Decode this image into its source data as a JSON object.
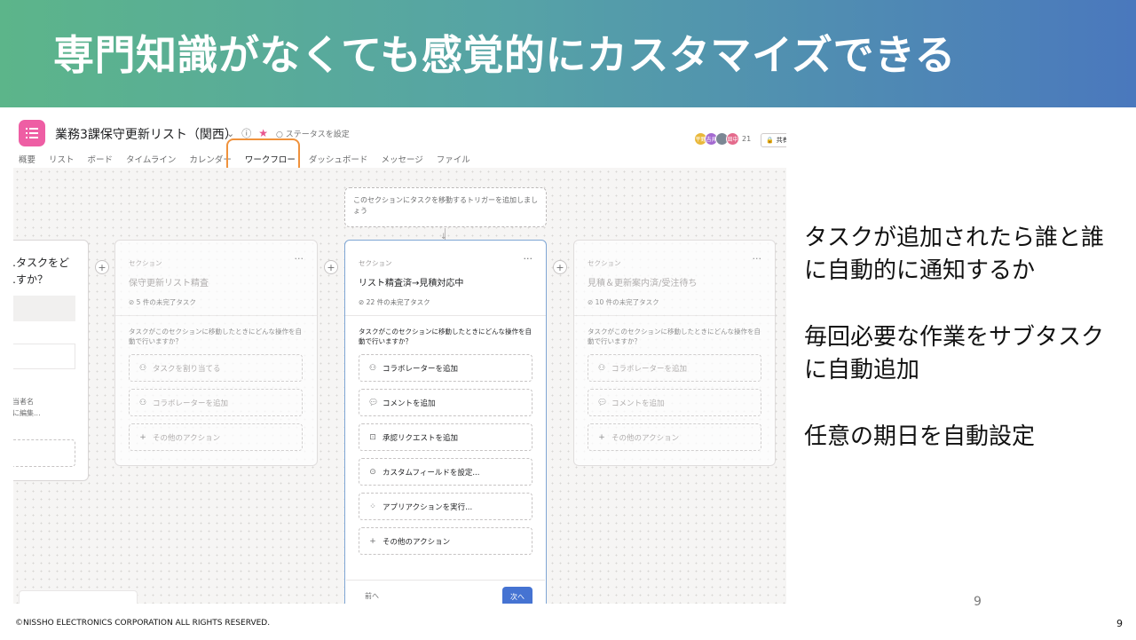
{
  "slide": {
    "title": "専門知識がなくても感覚的にカスタマイズできる",
    "points": [
      "タスクが追加されたら誰と誰に自動的に通知するか",
      "毎回必要な作業をサブタスクに自動追加",
      "任意の期日を自動設定"
    ],
    "page_mid": "9",
    "copyright": "©NISSHO ELECTRONICS CORPORATION ALL RIGHTS RESERVED.",
    "page_number": "9"
  },
  "app": {
    "project_title": "業務3課保守更新リスト（関西）",
    "status_label": "ステータスを設定",
    "member_count": "21",
    "share_label": "共有",
    "avatars": [
      "平野",
      "吉井",
      "",
      "田中"
    ],
    "tabs": [
      "概要",
      "リスト",
      "ボード",
      "タイムライン",
      "カレンダー",
      "ワークフロー",
      "ダッシュボード",
      "メッセージ",
      "ファイル"
    ],
    "active_tab": "ワークフロー",
    "trigger_text": "このセクションにタスクを移動するトリガーを追加しましょう",
    "partial_card": {
      "question": "…タスクをど\n…すか？",
      "text": "担当者名\n…に編集..."
    },
    "sections": [
      {
        "label": "セクション",
        "name": "保守更新リスト精査",
        "count": "5 件の未完了タスク",
        "prompt": "タスクがこのセクションに移動したときにどんな操作を自動で行いますか？",
        "actions": [
          "タスクを割り当てる",
          "コラボレーターを追加",
          "その他のアクション"
        ]
      },
      {
        "label": "セクション",
        "name": "リスト精査済→見積対応中",
        "count": "22 件の未完了タスク",
        "prompt": "タスクがこのセクションに移動したときにどんな操作を自動で行いますか？",
        "actions": [
          "コラボレーターを追加",
          "コメントを追加",
          "承認リクエストを追加",
          "カスタムフィールドを設定...",
          "アプリアクションを実行...",
          "その他のアクション"
        ],
        "prev_label": "前へ",
        "next_label": "次へ"
      },
      {
        "label": "セクション",
        "name": "見積＆更新案内済/受注待ち",
        "count": "10 件の未完了タスク",
        "prompt": "タスクがこのセクションに移動したときにどんな操作を自動で行いますか？",
        "actions": [
          "コラボレーターを追加",
          "コメントを追加",
          "その他のアクション"
        ]
      }
    ]
  },
  "colors": {
    "banner_start": "#5cb58a",
    "banner_end": "#4a78bd",
    "highlight": "#f0923c",
    "app_icon": "#ee5ea4",
    "primary_button": "#4573d2"
  }
}
